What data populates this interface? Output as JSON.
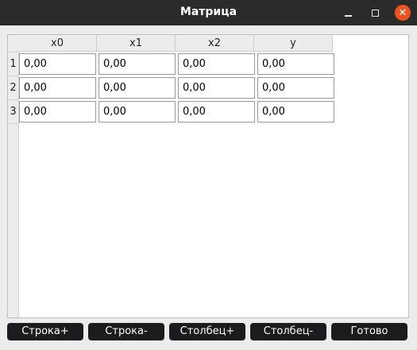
{
  "window": {
    "title": "Матрица"
  },
  "table": {
    "columns": [
      "x0",
      "x1",
      "x2",
      "y"
    ],
    "row_labels": [
      "1",
      "2",
      "3"
    ],
    "rows": [
      [
        "0,00",
        "0,00",
        "0,00",
        "0,00"
      ],
      [
        "0,00",
        "0,00",
        "0,00",
        "0,00"
      ],
      [
        "0,00",
        "0,00",
        "0,00",
        "0,00"
      ]
    ]
  },
  "buttons": {
    "add_row": "Строка+",
    "remove_row": "Строка-",
    "add_col": "Столбец+",
    "remove_col": "Столбец-",
    "done": "Готово"
  },
  "colors": {
    "titlebar": "#2b2b2b",
    "close_button": "#e9541f",
    "button_bg": "#1b1b20"
  },
  "icons": {
    "minimize": "minimize-icon",
    "maximize": "maximize-icon",
    "close": "close-icon"
  }
}
